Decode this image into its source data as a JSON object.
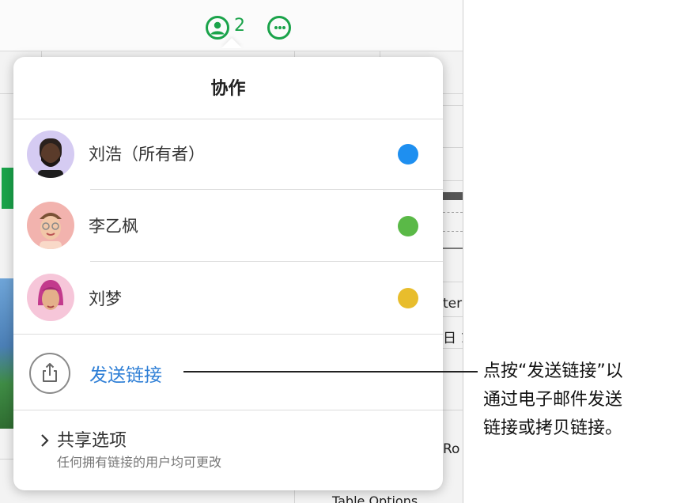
{
  "toolbar": {
    "collaborators_count": "2"
  },
  "background": {
    "fragments": [
      "ter",
      "日 1",
      "Ro",
      "Table Options"
    ]
  },
  "popover": {
    "title": "协作",
    "participants": [
      {
        "name": "刘浩（所有者）",
        "color": "#1e8ff0"
      },
      {
        "name": "李乙枫",
        "color": "#5ab947"
      },
      {
        "name": "刘梦",
        "color": "#e8bd2c"
      }
    ],
    "send_link": "发送链接",
    "share_options": {
      "title": "共享选项",
      "subtitle": "任何拥有链接的用户均可更改"
    }
  },
  "callout": {
    "lines": [
      "点按“发送链接”以",
      "通过电子邮件发送",
      "链接或拷贝链接。"
    ]
  }
}
